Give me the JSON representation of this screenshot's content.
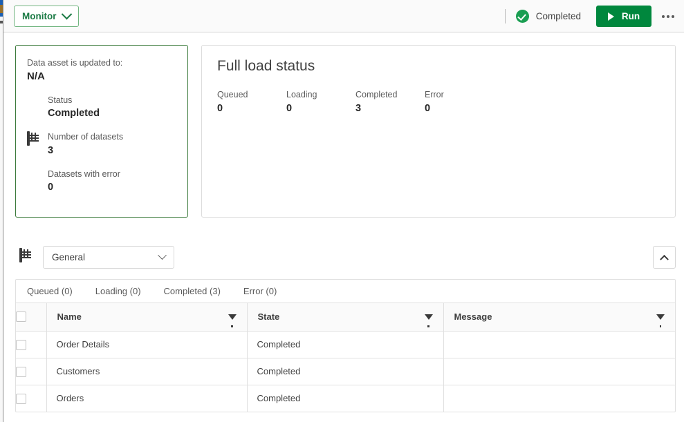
{
  "header": {
    "monitor_button": "Monitor",
    "monitor_chevron_icon": "chevron-down-icon",
    "status_icon": "check-circle-icon",
    "status_text": "Completed",
    "run_button": "Run",
    "run_icon": "play-icon",
    "more_icon": "kebab-menu-icon",
    "accent_green": "#00873d",
    "status_green": "#1a9e52"
  },
  "summary_card": {
    "asset_label": "Data asset is updated to:",
    "asset_value": "N/A",
    "border_color": "#3b7a3b",
    "metrics": [
      {
        "icon": "check-circle-icon",
        "label": "Status",
        "value": "Completed"
      },
      {
        "icon": "table-grid-icon",
        "label": "Number of datasets",
        "value": "3"
      },
      {
        "icon": "error-exclamation-icon",
        "label": "Datasets with error",
        "value": "0"
      }
    ]
  },
  "load_panel": {
    "title": "Full load status",
    "stats": [
      {
        "label": "Queued",
        "value": "0"
      },
      {
        "label": "Loading",
        "value": "0"
      },
      {
        "label": "Completed",
        "value": "3"
      },
      {
        "label": "Error",
        "value": "0"
      }
    ]
  },
  "toolbar": {
    "grid_icon": "table-grid-icon",
    "select_value": "General",
    "select_chevron_icon": "chevron-down-icon",
    "collapse_icon": "chevron-up-icon"
  },
  "tabs": [
    {
      "label": "Queued (0)"
    },
    {
      "label": "Loading (0)"
    },
    {
      "label": "Completed (3)"
    },
    {
      "label": "Error (0)"
    }
  ],
  "table": {
    "select_all_icon": "checkbox-icon",
    "filter_icon": "filter-funnel-icon",
    "columns": [
      {
        "label": "Name"
      },
      {
        "label": "State"
      },
      {
        "label": "Message"
      }
    ],
    "rows": [
      {
        "name": "Order Details",
        "state": "Completed",
        "message": ""
      },
      {
        "name": "Customers",
        "state": "Completed",
        "message": ""
      },
      {
        "name": "Orders",
        "state": "Completed",
        "message": ""
      }
    ]
  }
}
